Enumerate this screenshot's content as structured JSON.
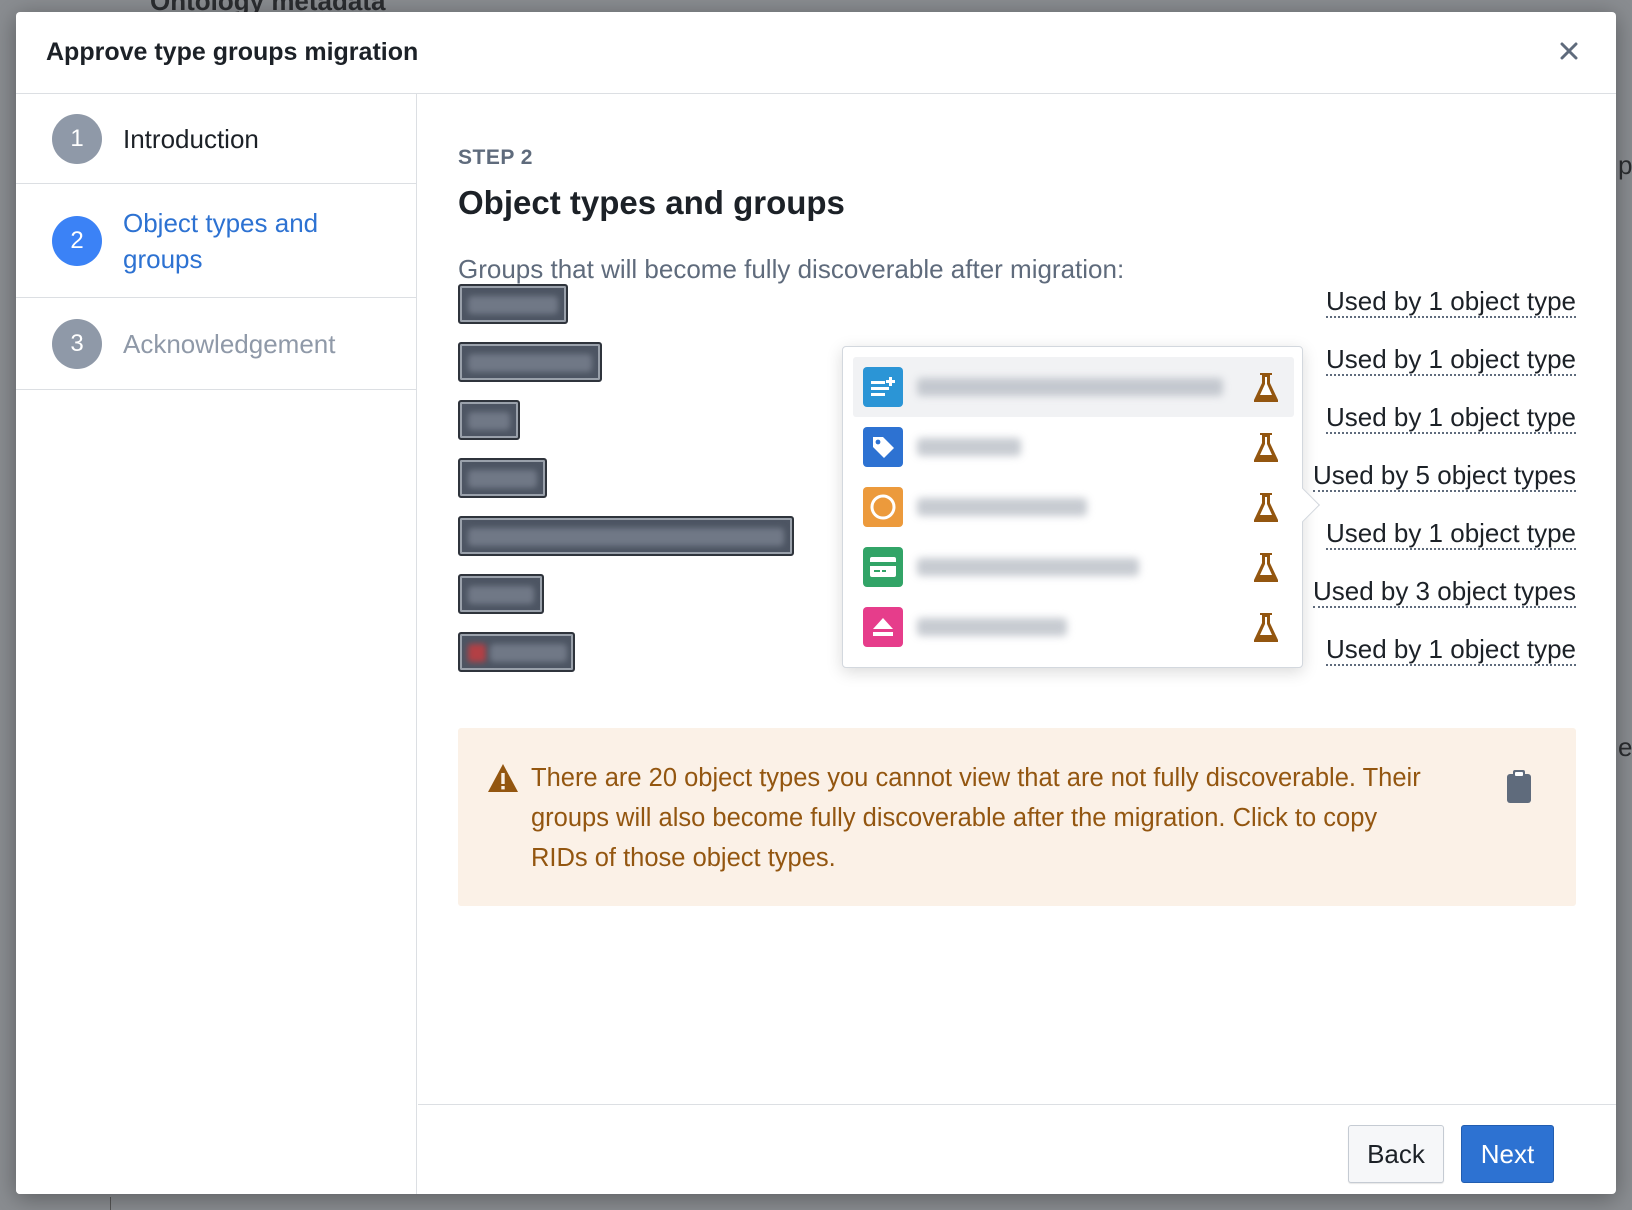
{
  "background": {
    "heading": "Ontology metadata",
    "right_fragment_1": "p",
    "right_fragment_2": "er"
  },
  "modal": {
    "title": "Approve type groups migration",
    "close_icon": "close-icon"
  },
  "steps": [
    {
      "number": "1",
      "label": "Introduction",
      "state": "completed"
    },
    {
      "number": "2",
      "label": "Object types and groups",
      "state": "active"
    },
    {
      "number": "3",
      "label": "Acknowledgement",
      "state": "upcoming"
    }
  ],
  "content": {
    "kicker": "STEP 2",
    "title": "Object types and groups",
    "description": "Groups that will become fully discoverable after migration:",
    "groups": [
      {
        "usage": "Used by 1 object type",
        "redacted": true
      },
      {
        "usage": "Used by 1 object type",
        "redacted": true
      },
      {
        "usage": "Used by 1 object type",
        "redacted": true
      },
      {
        "usage": "Used by 5 object types",
        "redacted": true
      },
      {
        "usage": "Used by 1 object type",
        "redacted": true
      },
      {
        "usage": "Used by 3 object types",
        "redacted": true
      },
      {
        "usage": "Used by 1 object type",
        "redacted": true
      }
    ],
    "popover": {
      "items": [
        {
          "icon": "list-add-icon",
          "color": "#2b95d6",
          "redacted": true
        },
        {
          "icon": "tag-icon",
          "color": "#2d72d2",
          "redacted": true
        },
        {
          "icon": "circle-icon",
          "color": "#ec9a3c",
          "redacted": true
        },
        {
          "icon": "credit-card-icon",
          "color": "#32a467",
          "redacted": true
        },
        {
          "icon": "eject-icon",
          "color": "#e63d8b",
          "redacted": true
        }
      ],
      "status_icon": "flask-icon",
      "status_color": "#935610"
    },
    "warning": {
      "icon": "warning-icon",
      "text": "There are 20 object types you cannot view that are not fully discoverable. Their groups will also become fully discoverable after the migration. Click to copy RIDs of those object types.",
      "copy_icon": "clipboard-icon"
    }
  },
  "footer": {
    "back_label": "Back",
    "next_label": "Next"
  },
  "colors": {
    "primary": "#2d72d2",
    "warning_bg": "#fbf1e7",
    "warning_text": "#935610"
  }
}
